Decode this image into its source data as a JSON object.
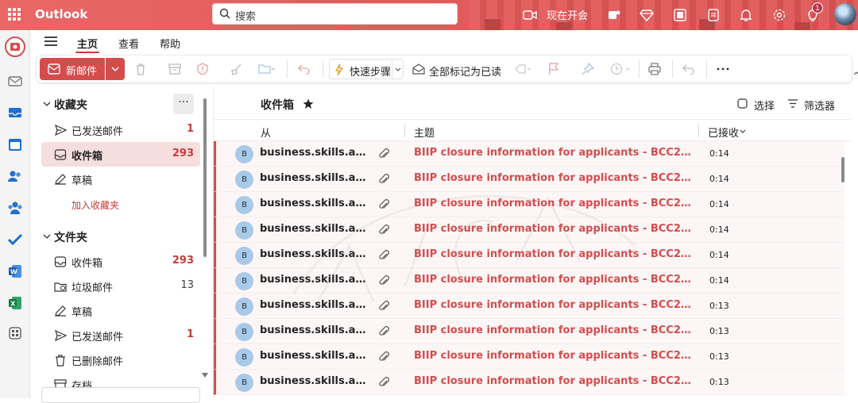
{
  "app": {
    "name": "Outlook"
  },
  "search": {
    "placeholder": "搜索"
  },
  "topbar": {
    "meet_now": "现在开会",
    "notification_count": "1",
    "accent": "#e25c5c"
  },
  "tabs": [
    {
      "label": "主页"
    },
    {
      "label": "查看"
    },
    {
      "label": "帮助"
    }
  ],
  "ribbon": {
    "new_mail": "新邮件",
    "quick_steps": "快速步骤",
    "mark_all_read": "全部标记为已读"
  },
  "favorites": {
    "title": "收藏夹",
    "more": "···",
    "items": [
      {
        "label": "已发送邮件",
        "count": "1",
        "icon": "send-icon"
      },
      {
        "label": "收件箱",
        "count": "293",
        "icon": "inbox-icon"
      },
      {
        "label": "草稿",
        "count": "",
        "icon": "draft-icon"
      }
    ],
    "add": "加入收藏夹"
  },
  "folders": {
    "title": "文件夹",
    "items": [
      {
        "label": "收件箱",
        "count": "293",
        "icon": "inbox-icon"
      },
      {
        "label": "垃圾邮件",
        "count": "13",
        "icon": "junk-icon"
      },
      {
        "label": "草稿",
        "count": "",
        "icon": "draft-icon"
      },
      {
        "label": "已发送邮件",
        "count": "1",
        "icon": "send-icon"
      },
      {
        "label": "已删除邮件",
        "count": "",
        "icon": "trash-icon"
      },
      {
        "label": "存档",
        "count": "",
        "icon": "archive-icon"
      }
    ]
  },
  "mail_list": {
    "title": "收件箱",
    "select": "选择",
    "filter": "筛选器",
    "columns": {
      "from": "从",
      "subject": "主题",
      "received": "已接收"
    },
    "rows": [
      {
        "avatar": "B",
        "from": "business.skills.ad...",
        "subject": "BIIP closure information for applicants - BCC202...",
        "time": "0:14"
      },
      {
        "avatar": "B",
        "from": "business.skills.ad...",
        "subject": "BIIP closure information for applicants - BCC202...",
        "time": "0:14"
      },
      {
        "avatar": "B",
        "from": "business.skills.ad...",
        "subject": "BIIP closure information for applicants - BCC202...",
        "time": "0:14"
      },
      {
        "avatar": "B",
        "from": "business.skills.ad...",
        "subject": "BIIP closure information for applicants - BCC202...",
        "time": "0:14"
      },
      {
        "avatar": "B",
        "from": "business.skills.ad...",
        "subject": "BIIP closure information for applicants - BCC202...",
        "time": "0:14"
      },
      {
        "avatar": "B",
        "from": "business.skills.ad...",
        "subject": "BIIP closure information for applicants - BCC202...",
        "time": "0:14"
      },
      {
        "avatar": "B",
        "from": "business.skills.ad...",
        "subject": "BIIP closure information for applicants - BCC202...",
        "time": "0:13"
      },
      {
        "avatar": "B",
        "from": "business.skills.ad...",
        "subject": "BIIP closure information for applicants - BCC202...",
        "time": "0:13"
      },
      {
        "avatar": "B",
        "from": "business.skills.ad...",
        "subject": "BIIP closure information for applicants - BCC202...",
        "time": "0:13"
      },
      {
        "avatar": "B",
        "from": "business.skills.ad...",
        "subject": "BIIP closure information for applicants - BCC202...",
        "time": "0:13"
      }
    ]
  }
}
